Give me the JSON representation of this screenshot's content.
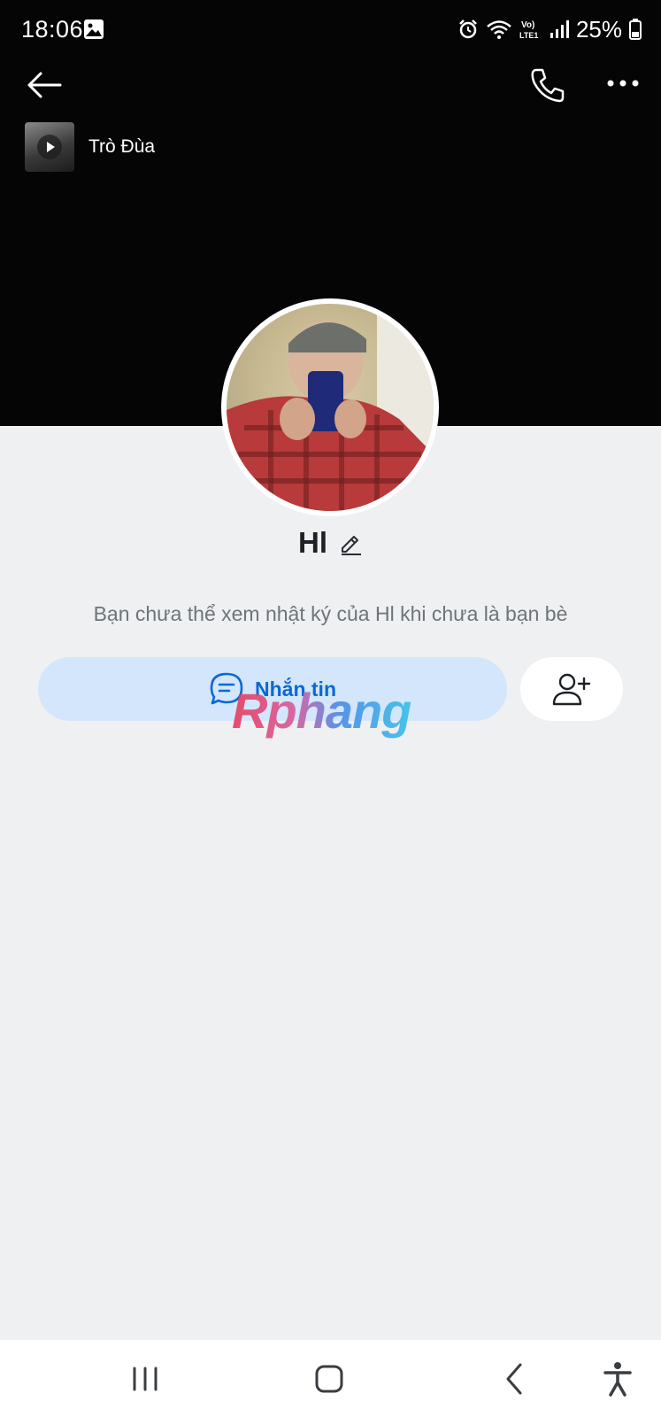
{
  "status_bar": {
    "time": "18:06",
    "battery_percent": "25%",
    "icons": [
      "gallery-icon",
      "alarm-icon",
      "wifi-icon",
      "volte-icon",
      "signal-icon",
      "battery-icon"
    ]
  },
  "top_nav": {
    "icons": [
      "back-arrow-icon",
      "phone-icon",
      "more-horizontal-icon"
    ]
  },
  "music": {
    "title": "Trò Đùa"
  },
  "profile": {
    "name": "Hl",
    "notice": "Bạn chưa thể xem nhật ký của Hl khi chưa là bạn bè"
  },
  "actions": {
    "message_label": "Nhắn tin",
    "message_icon": "chat-bubble-icon",
    "add_friend_icon": "add-user-icon"
  },
  "watermark": "Rphang",
  "system_nav": {
    "icons": [
      "recents-icon",
      "home-icon",
      "back-icon",
      "accessibility-icon"
    ]
  },
  "colors": {
    "cover": "#050505",
    "page_background": "#eef0f2",
    "message_button_bg": "#d3e6fb",
    "message_button_text": "#0a68d6",
    "notice_text": "#6e747a"
  }
}
